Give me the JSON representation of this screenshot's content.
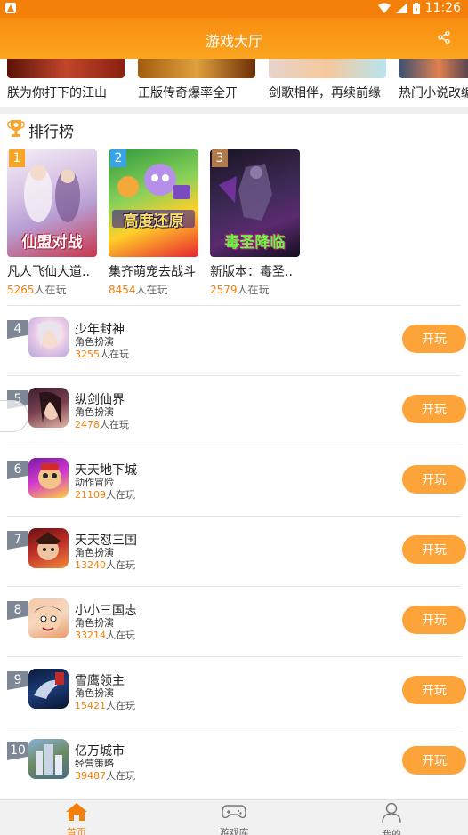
{
  "status_bar": {
    "left_icon": "android-notification-icon",
    "time": "11:26"
  },
  "header": {
    "title": "游戏大厅",
    "share_icon": "share-icon"
  },
  "banner": {
    "items": [
      {
        "label": "朕为你打下的江山"
      },
      {
        "label": "正版传奇爆率全开"
      },
      {
        "label": "剑歌相伴，再续前缘"
      },
      {
        "label": "热门小说改编"
      }
    ]
  },
  "ranking": {
    "title": "排行榜",
    "top3": [
      {
        "rank": "1",
        "cover_text": "仙盟对战",
        "name": "凡人飞仙大道..",
        "players": "5265",
        "players_suffix": "人在玩"
      },
      {
        "rank": "2",
        "cover_text": "高度还原",
        "name": "集齐萌宠去战斗",
        "players": "8454",
        "players_suffix": "人在玩"
      },
      {
        "rank": "3",
        "cover_text": "毒圣降临",
        "name": "新版本：毒圣..",
        "players": "2579",
        "players_suffix": "人在玩"
      }
    ],
    "list": [
      {
        "rank": "4",
        "name": "少年封神",
        "category": "角色扮演",
        "players": "3255",
        "players_suffix": "人在玩",
        "button": "开玩"
      },
      {
        "rank": "5",
        "name": "纵剑仙界",
        "category": "角色扮演",
        "players": "2478",
        "players_suffix": "人在玩",
        "button": "开玩"
      },
      {
        "rank": "6",
        "name": "天天地下城",
        "category": "动作冒险",
        "players": "21109",
        "players_suffix": "人在玩",
        "button": "开玩"
      },
      {
        "rank": "7",
        "name": "天天怼三国",
        "category": "角色扮演",
        "players": "13240",
        "players_suffix": "人在玩",
        "button": "开玩"
      },
      {
        "rank": "8",
        "name": "小小三国志",
        "category": "角色扮演",
        "players": "33214",
        "players_suffix": "人在玩",
        "button": "开玩"
      },
      {
        "rank": "9",
        "name": "雪鹰领主",
        "category": "角色扮演",
        "players": "15421",
        "players_suffix": "人在玩",
        "button": "开玩"
      },
      {
        "rank": "10",
        "name": "亿万城市",
        "category": "经营策略",
        "players": "39487",
        "players_suffix": "人在玩",
        "button": "开玩"
      }
    ]
  },
  "tabbar": {
    "tabs": [
      {
        "label": "首页",
        "icon": "home-icon",
        "active": true
      },
      {
        "label": "游戏库",
        "icon": "gamepad-icon",
        "active": false
      },
      {
        "label": "我的",
        "icon": "user-icon",
        "active": false
      }
    ]
  },
  "colors": {
    "accent": "#f47f09",
    "button": "#fca33a",
    "rank_badge": "#7d8795"
  }
}
